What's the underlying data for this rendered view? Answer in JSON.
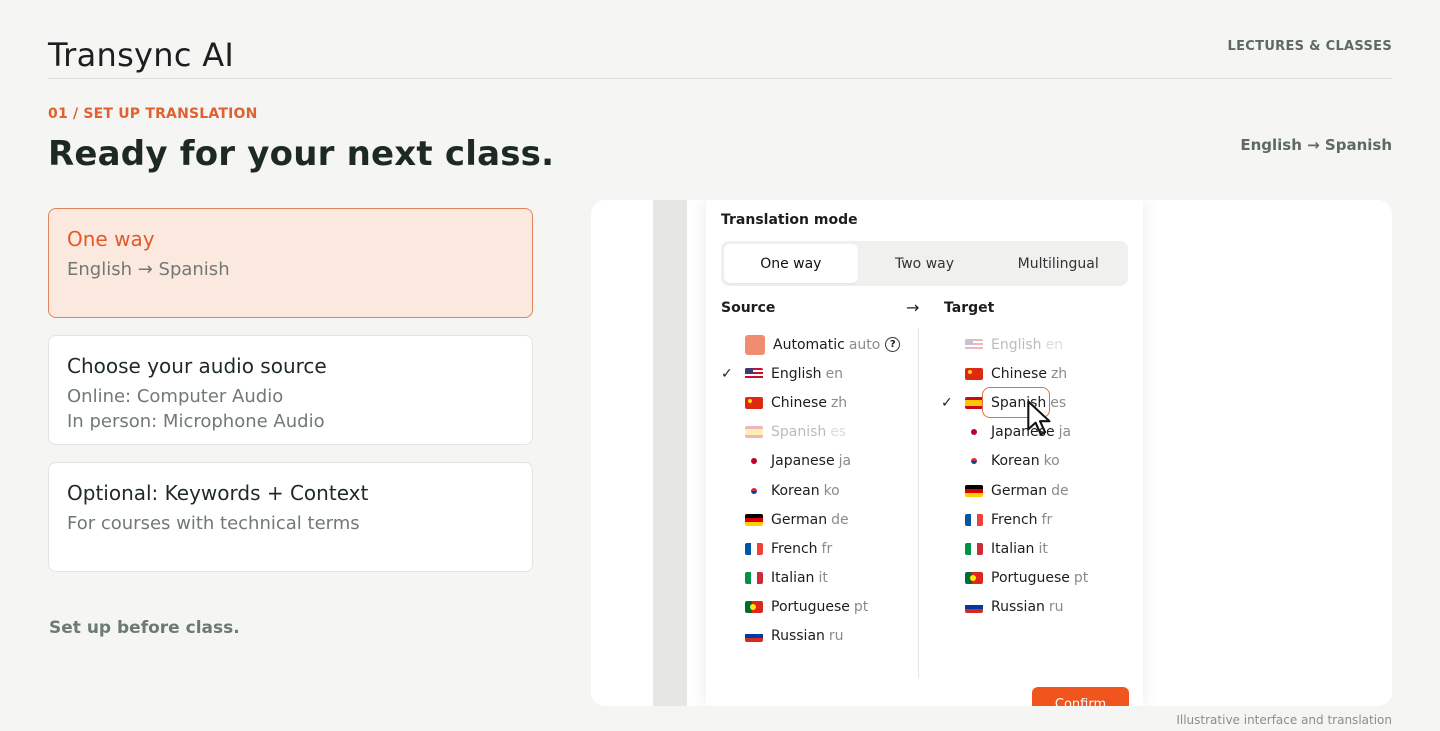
{
  "header": {
    "brand": "Transync AI",
    "section": "LECTURES & CLASSES"
  },
  "intro": {
    "step": "01 / SET UP TRANSLATION",
    "headline": "Ready for your next class.",
    "pair_label": "English → Spanish"
  },
  "cards": [
    {
      "title": "One way",
      "lines": [
        "English → Spanish"
      ]
    },
    {
      "title": "Choose your audio source",
      "lines": [
        "Online: Computer Audio",
        "In person: Microphone Audio"
      ]
    },
    {
      "title": "Optional: Keywords + Context",
      "lines": [
        "For courses with technical terms"
      ]
    }
  ],
  "footnote": "Set up before class.",
  "panel": {
    "title": "Translation mode",
    "modes": [
      "One way",
      "Two way",
      "Multilingual"
    ],
    "selected_mode": "One way",
    "source_label": "Source",
    "target_label": "Target",
    "arrow": "→",
    "source_languages": [
      {
        "name": "Automatic",
        "code": "auto",
        "flag": "auto",
        "help": "?"
      },
      {
        "name": "English",
        "code": "en",
        "flag": "us",
        "checked": true
      },
      {
        "name": "Chinese",
        "code": "zh",
        "flag": "cn"
      },
      {
        "name": "Spanish",
        "code": "es",
        "flag": "es",
        "disabled": true
      },
      {
        "name": "Japanese",
        "code": "ja",
        "flag": "jp"
      },
      {
        "name": "Korean",
        "code": "ko",
        "flag": "kr"
      },
      {
        "name": "German",
        "code": "de",
        "flag": "de"
      },
      {
        "name": "French",
        "code": "fr",
        "flag": "fr"
      },
      {
        "name": "Italian",
        "code": "it",
        "flag": "it"
      },
      {
        "name": "Portuguese",
        "code": "pt",
        "flag": "pt"
      },
      {
        "name": "Russian",
        "code": "ru",
        "flag": "ru"
      }
    ],
    "target_languages": [
      {
        "name": "English",
        "code": "en",
        "flag": "us",
        "disabled": true
      },
      {
        "name": "Chinese",
        "code": "zh",
        "flag": "cn"
      },
      {
        "name": "Spanish",
        "code": "es",
        "flag": "es",
        "checked": true
      },
      {
        "name": "Japanese",
        "code": "ja",
        "flag": "jp"
      },
      {
        "name": "Korean",
        "code": "ko",
        "flag": "kr"
      },
      {
        "name": "German",
        "code": "de",
        "flag": "de"
      },
      {
        "name": "French",
        "code": "fr",
        "flag": "fr"
      },
      {
        "name": "Italian",
        "code": "it",
        "flag": "it"
      },
      {
        "name": "Portuguese",
        "code": "pt",
        "flag": "pt"
      },
      {
        "name": "Russian",
        "code": "ru",
        "flag": "ru"
      }
    ],
    "check_mark": "✓",
    "confirm_label": "Confirm"
  },
  "caption": "Illustrative interface and translation",
  "colors": {
    "accent": "#f0551d",
    "accent_soft": "#fbe8df",
    "text_dark": "#1d2a24",
    "muted": "#6d7a72"
  }
}
